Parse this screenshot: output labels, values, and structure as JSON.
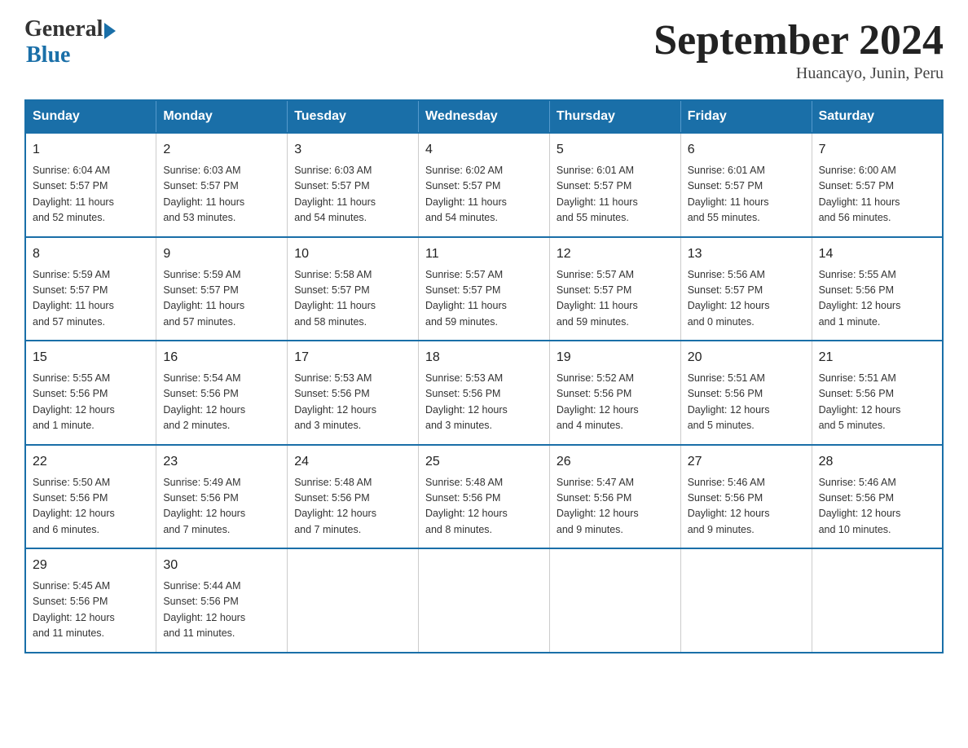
{
  "header": {
    "logo_general": "General",
    "logo_blue": "Blue",
    "month_title": "September 2024",
    "location": "Huancayo, Junin, Peru"
  },
  "days_of_week": [
    "Sunday",
    "Monday",
    "Tuesday",
    "Wednesday",
    "Thursday",
    "Friday",
    "Saturday"
  ],
  "weeks": [
    [
      {
        "day": "1",
        "info": "Sunrise: 6:04 AM\nSunset: 5:57 PM\nDaylight: 11 hours\nand 52 minutes."
      },
      {
        "day": "2",
        "info": "Sunrise: 6:03 AM\nSunset: 5:57 PM\nDaylight: 11 hours\nand 53 minutes."
      },
      {
        "day": "3",
        "info": "Sunrise: 6:03 AM\nSunset: 5:57 PM\nDaylight: 11 hours\nand 54 minutes."
      },
      {
        "day": "4",
        "info": "Sunrise: 6:02 AM\nSunset: 5:57 PM\nDaylight: 11 hours\nand 54 minutes."
      },
      {
        "day": "5",
        "info": "Sunrise: 6:01 AM\nSunset: 5:57 PM\nDaylight: 11 hours\nand 55 minutes."
      },
      {
        "day": "6",
        "info": "Sunrise: 6:01 AM\nSunset: 5:57 PM\nDaylight: 11 hours\nand 55 minutes."
      },
      {
        "day": "7",
        "info": "Sunrise: 6:00 AM\nSunset: 5:57 PM\nDaylight: 11 hours\nand 56 minutes."
      }
    ],
    [
      {
        "day": "8",
        "info": "Sunrise: 5:59 AM\nSunset: 5:57 PM\nDaylight: 11 hours\nand 57 minutes."
      },
      {
        "day": "9",
        "info": "Sunrise: 5:59 AM\nSunset: 5:57 PM\nDaylight: 11 hours\nand 57 minutes."
      },
      {
        "day": "10",
        "info": "Sunrise: 5:58 AM\nSunset: 5:57 PM\nDaylight: 11 hours\nand 58 minutes."
      },
      {
        "day": "11",
        "info": "Sunrise: 5:57 AM\nSunset: 5:57 PM\nDaylight: 11 hours\nand 59 minutes."
      },
      {
        "day": "12",
        "info": "Sunrise: 5:57 AM\nSunset: 5:57 PM\nDaylight: 11 hours\nand 59 minutes."
      },
      {
        "day": "13",
        "info": "Sunrise: 5:56 AM\nSunset: 5:57 PM\nDaylight: 12 hours\nand 0 minutes."
      },
      {
        "day": "14",
        "info": "Sunrise: 5:55 AM\nSunset: 5:56 PM\nDaylight: 12 hours\nand 1 minute."
      }
    ],
    [
      {
        "day": "15",
        "info": "Sunrise: 5:55 AM\nSunset: 5:56 PM\nDaylight: 12 hours\nand 1 minute."
      },
      {
        "day": "16",
        "info": "Sunrise: 5:54 AM\nSunset: 5:56 PM\nDaylight: 12 hours\nand 2 minutes."
      },
      {
        "day": "17",
        "info": "Sunrise: 5:53 AM\nSunset: 5:56 PM\nDaylight: 12 hours\nand 3 minutes."
      },
      {
        "day": "18",
        "info": "Sunrise: 5:53 AM\nSunset: 5:56 PM\nDaylight: 12 hours\nand 3 minutes."
      },
      {
        "day": "19",
        "info": "Sunrise: 5:52 AM\nSunset: 5:56 PM\nDaylight: 12 hours\nand 4 minutes."
      },
      {
        "day": "20",
        "info": "Sunrise: 5:51 AM\nSunset: 5:56 PM\nDaylight: 12 hours\nand 5 minutes."
      },
      {
        "day": "21",
        "info": "Sunrise: 5:51 AM\nSunset: 5:56 PM\nDaylight: 12 hours\nand 5 minutes."
      }
    ],
    [
      {
        "day": "22",
        "info": "Sunrise: 5:50 AM\nSunset: 5:56 PM\nDaylight: 12 hours\nand 6 minutes."
      },
      {
        "day": "23",
        "info": "Sunrise: 5:49 AM\nSunset: 5:56 PM\nDaylight: 12 hours\nand 7 minutes."
      },
      {
        "day": "24",
        "info": "Sunrise: 5:48 AM\nSunset: 5:56 PM\nDaylight: 12 hours\nand 7 minutes."
      },
      {
        "day": "25",
        "info": "Sunrise: 5:48 AM\nSunset: 5:56 PM\nDaylight: 12 hours\nand 8 minutes."
      },
      {
        "day": "26",
        "info": "Sunrise: 5:47 AM\nSunset: 5:56 PM\nDaylight: 12 hours\nand 9 minutes."
      },
      {
        "day": "27",
        "info": "Sunrise: 5:46 AM\nSunset: 5:56 PM\nDaylight: 12 hours\nand 9 minutes."
      },
      {
        "day": "28",
        "info": "Sunrise: 5:46 AM\nSunset: 5:56 PM\nDaylight: 12 hours\nand 10 minutes."
      }
    ],
    [
      {
        "day": "29",
        "info": "Sunrise: 5:45 AM\nSunset: 5:56 PM\nDaylight: 12 hours\nand 11 minutes."
      },
      {
        "day": "30",
        "info": "Sunrise: 5:44 AM\nSunset: 5:56 PM\nDaylight: 12 hours\nand 11 minutes."
      },
      {
        "day": "",
        "info": ""
      },
      {
        "day": "",
        "info": ""
      },
      {
        "day": "",
        "info": ""
      },
      {
        "day": "",
        "info": ""
      },
      {
        "day": "",
        "info": ""
      }
    ]
  ]
}
